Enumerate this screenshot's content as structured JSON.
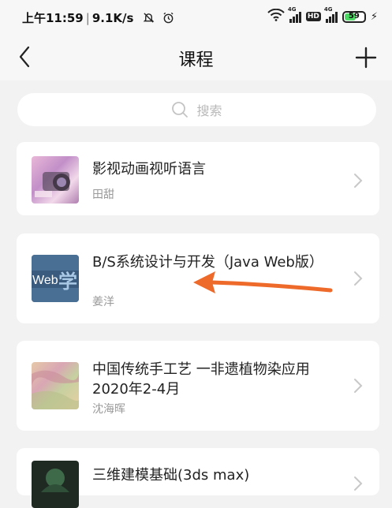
{
  "status_bar": {
    "time": "上午11:59",
    "net_speed": "9.1K/s",
    "sim1_type": "4G",
    "hd_label": "HD",
    "sim2_type": "4G",
    "battery_level": "59"
  },
  "nav": {
    "title": "课程"
  },
  "search": {
    "placeholder": "搜索"
  },
  "courses": [
    {
      "title": "影视动画视听语言",
      "teacher": "田甜"
    },
    {
      "title": "B/S系统设计与开发（Java Web版）",
      "teacher": "姜洋"
    },
    {
      "title": "中国传统手工艺 一非遗植物染应用2020年2-4月",
      "teacher": "沈海晖"
    },
    {
      "title": "三维建模基础(3ds max)",
      "teacher": ""
    }
  ],
  "thumb_text": {
    "web": "Web",
    "xue": "学"
  },
  "colors": {
    "accent_arrow": "#ee6a2a",
    "battery_fill": "#4cd964"
  }
}
